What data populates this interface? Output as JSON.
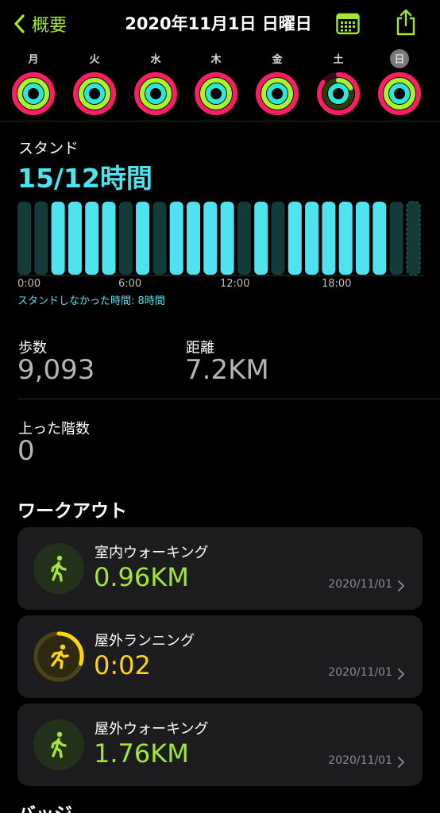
{
  "header": {
    "back_label": "概要",
    "title": "2020年11月1日 日曜日"
  },
  "week": [
    {
      "label": "月",
      "selected": false,
      "move": 1.0,
      "exercise": 1.0,
      "stand": 1.0
    },
    {
      "label": "火",
      "selected": false,
      "move": 1.0,
      "exercise": 1.0,
      "stand": 1.0
    },
    {
      "label": "水",
      "selected": false,
      "move": 1.0,
      "exercise": 1.0,
      "stand": 1.0
    },
    {
      "label": "木",
      "selected": false,
      "move": 1.0,
      "exercise": 1.0,
      "stand": 1.0
    },
    {
      "label": "金",
      "selected": false,
      "move": 1.0,
      "exercise": 1.0,
      "stand": 1.0
    },
    {
      "label": "土",
      "selected": false,
      "move": 0.85,
      "exercise": 0.18,
      "stand": 1.0
    },
    {
      "label": "日",
      "selected": true,
      "move": 1.0,
      "exercise": 1.0,
      "stand": 1.0
    }
  ],
  "colors": {
    "move": "#fa1e63",
    "exercise": "#a6f52a",
    "stand": "#2ee5d8",
    "stand_bar": "#4fe3f0",
    "stand_bar_off": "#123b3a",
    "accent_green": "#a3e635",
    "accent_yellow": "#ffd60a"
  },
  "stand": {
    "label": "スタンド",
    "value": "15/12時間",
    "axis_labels": [
      "0:00",
      "6:00",
      "12:00",
      "18:00"
    ],
    "no_stand_text": "スタンドしなかった時間: 8時間",
    "hours": [
      0,
      0,
      1,
      1,
      1,
      1,
      0,
      1,
      0,
      1,
      1,
      1,
      1,
      0,
      1,
      0,
      1,
      1,
      1,
      1,
      1,
      1,
      0,
      0
    ]
  },
  "stats": {
    "steps_label": "歩数",
    "steps_value": "9,093",
    "distance_label": "距離",
    "distance_value": "7.2KM",
    "floors_label": "上った階数",
    "floors_value": "0"
  },
  "workouts_title": "ワークアウト",
  "workouts": [
    {
      "name": "室内ウォーキング",
      "value": "0.96KM",
      "date": "2020/11/01",
      "icon": "walking-icon",
      "color": "#a3e635",
      "ring": 0
    },
    {
      "name": "屋外ランニング",
      "value": "0:02",
      "date": "2020/11/01",
      "icon": "running-icon",
      "color": "#ffd60a",
      "ring": 0.3
    },
    {
      "name": "屋外ウォーキング",
      "value": "1.76KM",
      "date": "2020/11/01",
      "icon": "walking-icon",
      "color": "#a3e635",
      "ring": 0
    }
  ],
  "badges_title": "バッジ"
}
